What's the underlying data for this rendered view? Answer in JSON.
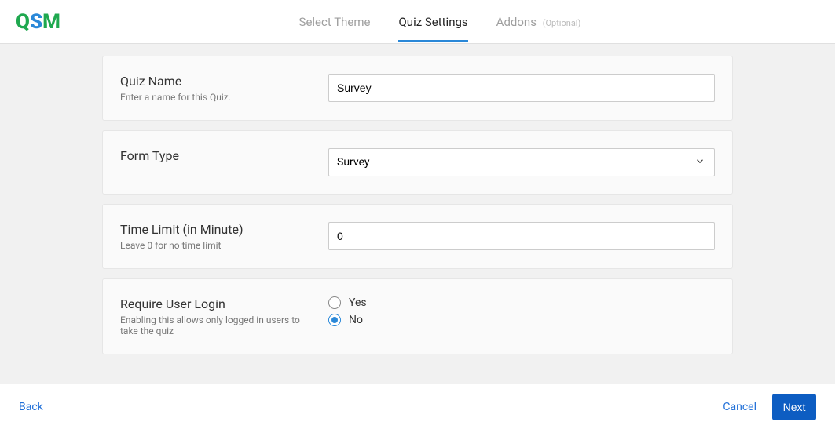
{
  "logo": {
    "q": "Q",
    "s": "S",
    "m": "M"
  },
  "tabs": {
    "select_theme": "Select Theme",
    "quiz_settings": "Quiz Settings",
    "addons": "Addons",
    "addons_optional": "(Optional)"
  },
  "sections": {
    "quiz_name": {
      "title": "Quiz Name",
      "help": "Enter a name for this Quiz.",
      "value": "Survey"
    },
    "form_type": {
      "title": "Form Type",
      "selected": "Survey"
    },
    "time_limit": {
      "title": "Time Limit (in Minute)",
      "help": "Leave 0 for no time limit",
      "value": "0"
    },
    "require_login": {
      "title": "Require User Login",
      "help": "Enabling this allows only logged in users to take the quiz",
      "options": {
        "yes": "Yes",
        "no": "No"
      },
      "selected": "no"
    }
  },
  "footer": {
    "back": "Back",
    "cancel": "Cancel",
    "next": "Next"
  }
}
